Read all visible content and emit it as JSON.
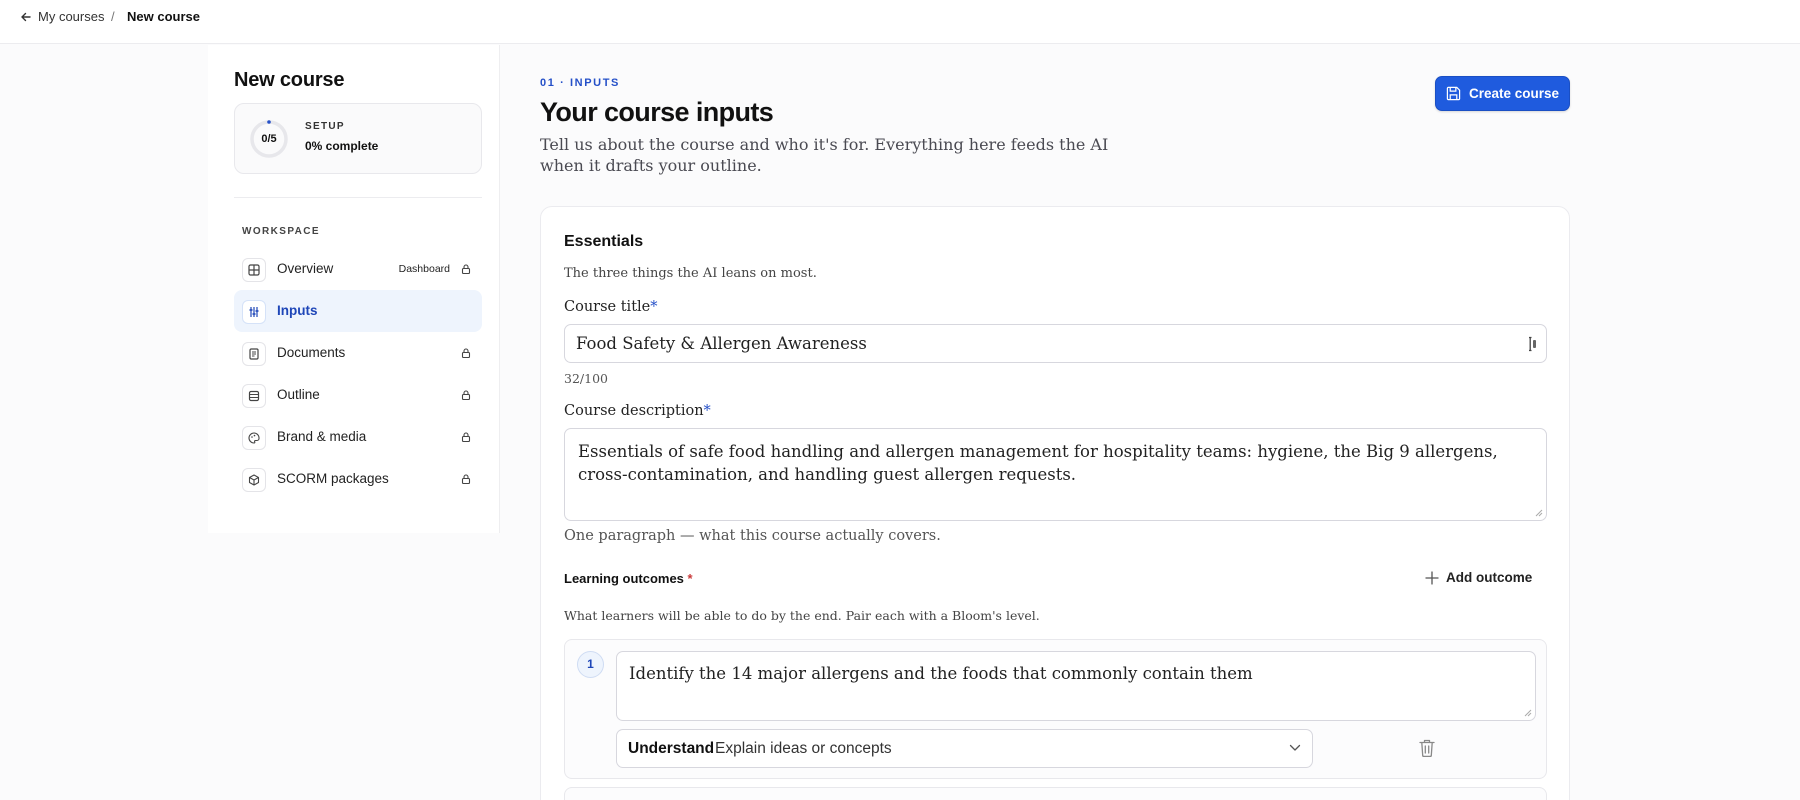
{
  "breadcrumb": {
    "back_label": "My courses",
    "separator": "/",
    "current": "New course"
  },
  "sidebar": {
    "title": "New course",
    "progress": {
      "count": "0/5",
      "kicker": "SETUP",
      "value": "0% complete",
      "fraction": 0
    },
    "section_label": "WORKSPACE",
    "items": [
      {
        "label": "Overview",
        "badge": "Dashboard",
        "icon": "grid-icon",
        "locked": true,
        "active": false
      },
      {
        "label": "Inputs",
        "badge": "",
        "icon": "sliders-icon",
        "locked": false,
        "active": true
      },
      {
        "label": "Documents",
        "badge": "",
        "icon": "document-icon",
        "locked": true,
        "active": false
      },
      {
        "label": "Outline",
        "badge": "",
        "icon": "list-icon",
        "locked": true,
        "active": false
      },
      {
        "label": "Brand & media",
        "badge": "",
        "icon": "palette-icon",
        "locked": true,
        "active": false
      },
      {
        "label": "SCORM packages",
        "badge": "",
        "icon": "package-icon",
        "locked": true,
        "active": false
      }
    ]
  },
  "header": {
    "kicker": "01 · INPUTS",
    "title": "Your course inputs",
    "subtitle": "Tell us about the course and who it's for. Everything here feeds the AI when it drafts your outline.",
    "create_button": "Create course"
  },
  "essentials": {
    "title": "Essentials",
    "subtitle": "The three things the AI leans on most.",
    "course_title_label": "Course title",
    "course_title_value": "Food Safety & Allergen Awareness",
    "course_title_counter": "32/100",
    "description_label": "Course description",
    "description_value": "Essentials of safe food handling and allergen management for hospitality teams: hygiene, the Big 9 allergens, cross-contamination, and handling guest allergen requests.",
    "description_helper": "One paragraph — what this course actually covers.",
    "required_mark": "*"
  },
  "outcomes": {
    "label": "Learning outcomes",
    "required_mark": "*",
    "add_button": "Add outcome",
    "subtitle": "What learners will be able to do by the end. Pair each with a Bloom's level.",
    "items": [
      {
        "number": "1",
        "text": "Identify the 14 major allergens and the foods that commonly contain them",
        "bloom_level": "Understand",
        "bloom_description": "Explain ideas or concepts"
      }
    ]
  },
  "colors": {
    "accent": "#1f5bde",
    "accent_text": "#2550c8",
    "active_nav_bg": "#eef4fd",
    "required_red": "#c93a3a"
  }
}
